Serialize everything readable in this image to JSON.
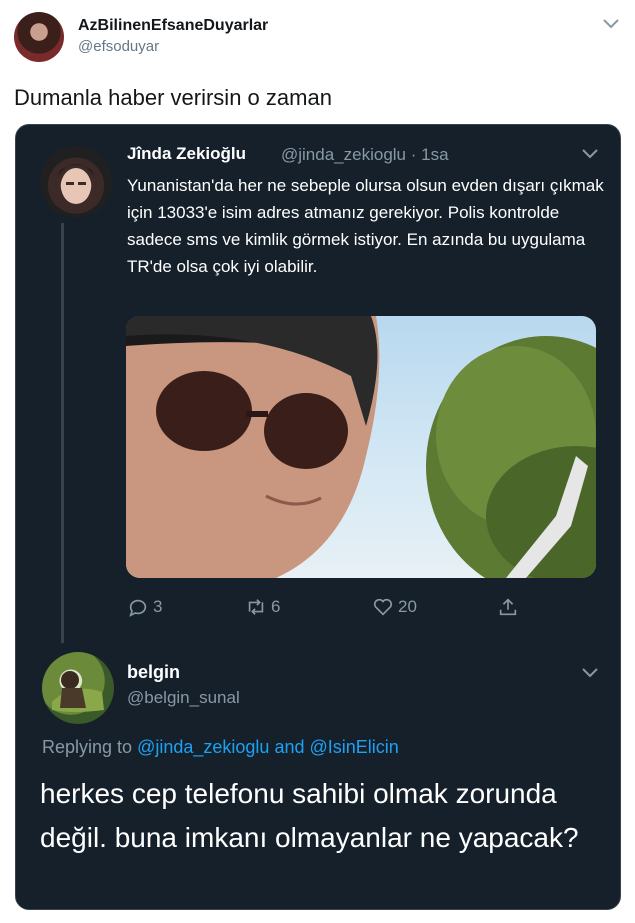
{
  "outer_tweet": {
    "name": "AzBilinenEfsaneDuyarlar",
    "handle": "@efsoduyar",
    "text": "Dumanla haber verirsin o zaman"
  },
  "quoted_tweet": {
    "name": "Jînda Zekioğlu",
    "handle_time": "@jinda_zekioglu · 1sa",
    "text": "Yunanistan'da her ne sebeple olursa olsun evden dışarı çıkmak için 13033'e isim adres atmanız gerekiyor. Polis kontrolde sadece sms ve kimlik görmek istiyor. En azında bu uygulama TR'de olsa çok iyi olabilir.",
    "actions": {
      "reply_count": "3",
      "retweet_count": "6",
      "like_count": "20"
    }
  },
  "reply_tweet": {
    "name": "belgin",
    "handle": "@belgin_sunal",
    "replying_prefix": "Replying to",
    "mention1": "@jinda_zekioglu",
    "and": "and",
    "mention2": "@IsinElicin",
    "text": "herkes cep telefonu sahibi olmak zorunda değil. buna imkanı olmayanlar ne yapacak?"
  },
  "colors": {
    "dark_bg": "#15202b",
    "muted": "#8899a6",
    "link": "#1da1f2"
  }
}
